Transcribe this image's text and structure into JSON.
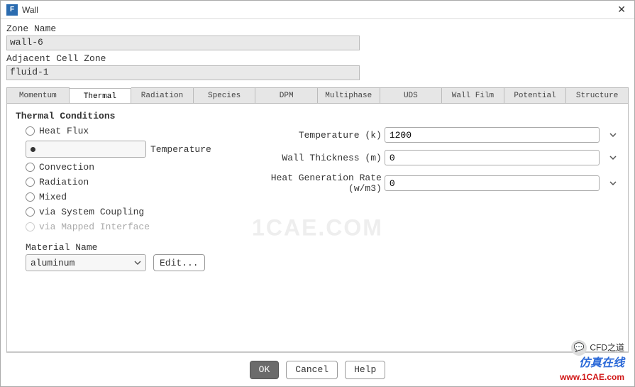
{
  "window": {
    "title": "Wall",
    "icon_letter": "F"
  },
  "zone_name": {
    "label": "Zone Name",
    "value": "wall-6"
  },
  "adj_zone": {
    "label": "Adjacent Cell Zone",
    "value": "fluid-1"
  },
  "tabs": [
    "Momentum",
    "Thermal",
    "Radiation",
    "Species",
    "DPM",
    "Multiphase",
    "UDS",
    "Wall Film",
    "Potential",
    "Structure"
  ],
  "active_tab": 1,
  "thermal": {
    "section_title": "Thermal Conditions",
    "radios": [
      {
        "label": "Heat Flux",
        "selected": false,
        "disabled": false
      },
      {
        "label": "Temperature",
        "selected": true,
        "disabled": false
      },
      {
        "label": "Convection",
        "selected": false,
        "disabled": false
      },
      {
        "label": "Radiation",
        "selected": false,
        "disabled": false
      },
      {
        "label": "Mixed",
        "selected": false,
        "disabled": false
      },
      {
        "label": "via System Coupling",
        "selected": false,
        "disabled": false
      },
      {
        "label": "via Mapped Interface",
        "selected": false,
        "disabled": true
      }
    ],
    "fields": [
      {
        "label": "Temperature (k)",
        "value": "1200"
      },
      {
        "label": "Wall Thickness (m)",
        "value": "0"
      },
      {
        "label": "Heat Generation Rate (w/m3)",
        "value": "0"
      }
    ],
    "material": {
      "label": "Material Name",
      "value": "aluminum",
      "edit_label": "Edit..."
    }
  },
  "footer": {
    "ok": "OK",
    "cancel": "Cancel",
    "help": "Help"
  },
  "watermark": "1CAE.COM",
  "brand": {
    "line1": "CFD之道",
    "line2": "仿真在线",
    "line3": "www.1CAE.com"
  }
}
